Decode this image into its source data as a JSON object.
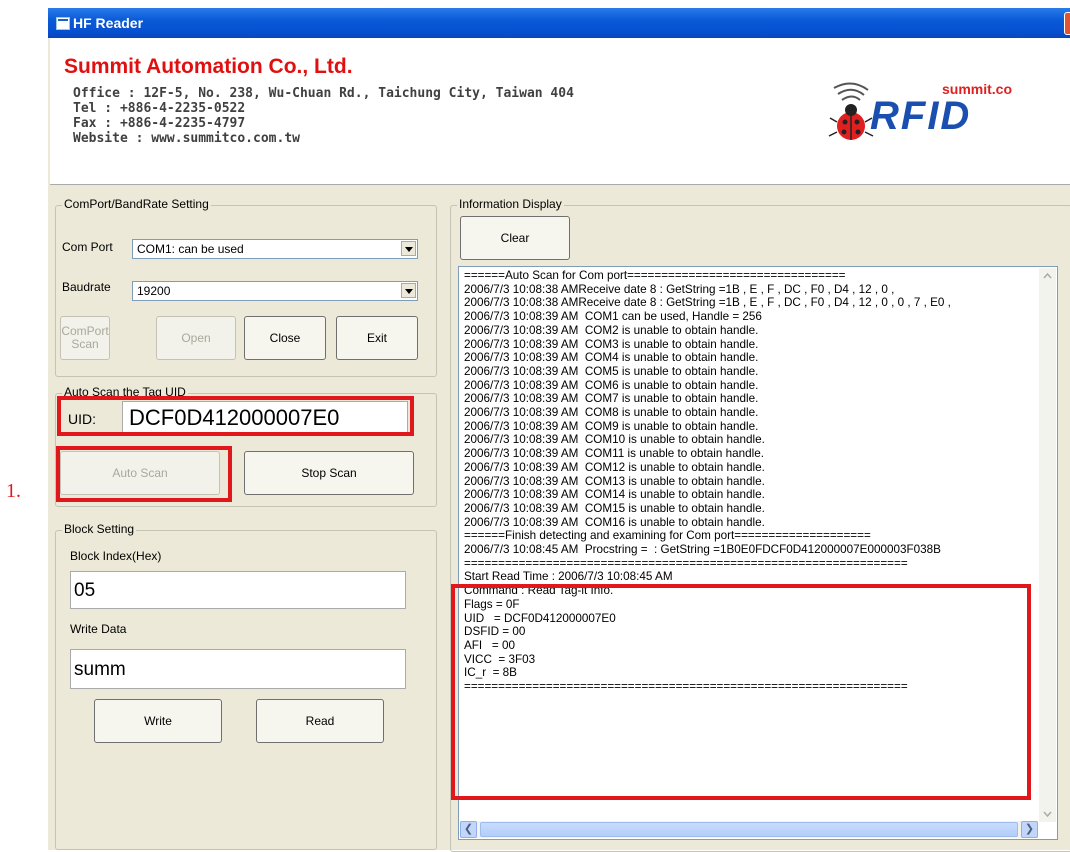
{
  "window": {
    "title": "HF Reader",
    "close_label": "X"
  },
  "header": {
    "company": "Summit Automation Co., Ltd.",
    "address": "Office : 12F-5, No. 238, Wu-Chuan Rd., Taichung City, Taiwan 404",
    "tel": "Tel : +886-4-2235-0522",
    "fax": "Fax : +886-4-2235-4797",
    "website": "Website : www.summitco.com.tw",
    "logo_small": "summit.co",
    "logo_big": "RFID"
  },
  "comport": {
    "group_label": "ComPort/BandRate Setting",
    "com_port_label": "Com Port",
    "com_port_value": "COM1: can be used",
    "baudrate_label": "Baudrate",
    "baudrate_value": "19200",
    "scan_label": "ComPort Scan",
    "open_label": "Open",
    "close_label": "Close",
    "exit_label": "Exit"
  },
  "autoscan": {
    "group_label": "Auto Scan the Tag UID",
    "uid_label": "UID:",
    "uid_value": "DCF0D412000007E0",
    "auto_scan_label": "Auto Scan",
    "stop_scan_label": "Stop Scan"
  },
  "annotation": {
    "step_label": "1."
  },
  "block": {
    "group_label": "Block Setting",
    "index_label": "Block Index(Hex)",
    "index_value": "05",
    "write_data_label": "Write Data",
    "write_data_value": "summ",
    "write_label": "Write",
    "read_label": "Read"
  },
  "info": {
    "group_label": "Information Display",
    "clear_label": "Clear",
    "log": [
      "======Auto Scan for Com port================================",
      "2006/7/3 10:08:38 AMReceive date 8 : GetString =1B , E , F , DC , F0 , D4 , 12 , 0 ,",
      "2006/7/3 10:08:38 AMReceive date 8 : GetString =1B , E , F , DC , F0 , D4 , 12 , 0 , 0 , 7 , E0 ,",
      "2006/7/3 10:08:39 AM  COM1 can be used, Handle = 256",
      "2006/7/3 10:08:39 AM  COM2 is unable to obtain handle.",
      "2006/7/3 10:08:39 AM  COM3 is unable to obtain handle.",
      "2006/7/3 10:08:39 AM  COM4 is unable to obtain handle.",
      "2006/7/3 10:08:39 AM  COM5 is unable to obtain handle.",
      "2006/7/3 10:08:39 AM  COM6 is unable to obtain handle.",
      "2006/7/3 10:08:39 AM  COM7 is unable to obtain handle.",
      "2006/7/3 10:08:39 AM  COM8 is unable to obtain handle.",
      "2006/7/3 10:08:39 AM  COM9 is unable to obtain handle.",
      "2006/7/3 10:08:39 AM  COM10 is unable to obtain handle.",
      "2006/7/3 10:08:39 AM  COM11 is unable to obtain handle.",
      "2006/7/3 10:08:39 AM  COM12 is unable to obtain handle.",
      "2006/7/3 10:08:39 AM  COM13 is unable to obtain handle.",
      "2006/7/3 10:08:39 AM  COM14 is unable to obtain handle.",
      "2006/7/3 10:08:39 AM  COM15 is unable to obtain handle.",
      "2006/7/3 10:08:39 AM  COM16 is unable to obtain handle.",
      "======Finish detecting and examining for Com port====================",
      "2006/7/3 10:08:45 AM  Procstring =  : GetString =1B0E0FDCF0D412000007E000003F038B",
      "=================================================================",
      "Start Read Time : 2006/7/3 10:08:45 AM",
      "Command : Read Tag-it Info.",
      "Flags = 0F",
      "UID   = DCF0D412000007E0",
      "DSFID = 00",
      "AFI   = 00",
      "VICC  = 3F03",
      "IC_r  = 8B",
      "================================================================="
    ]
  },
  "colors": {
    "highlight": "#e0181c",
    "title_bar": "#0a5ad8",
    "company": "#e01010"
  }
}
